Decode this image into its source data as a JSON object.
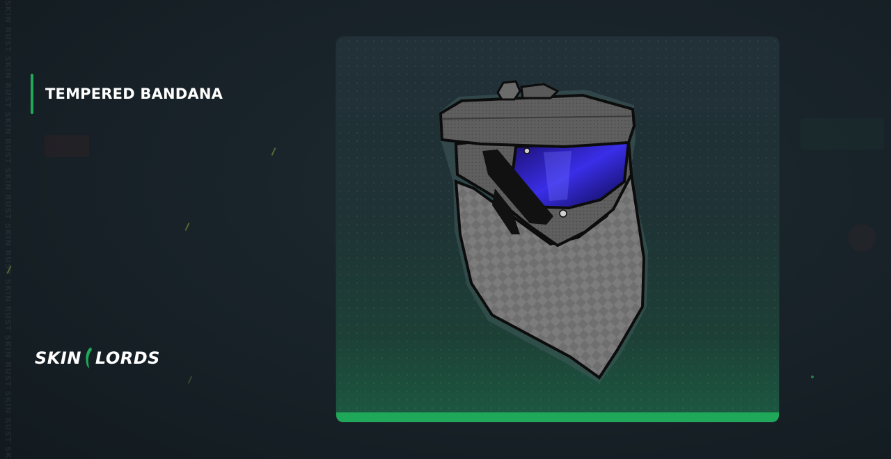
{
  "item": {
    "name": "TEMPERED BANDANA",
    "image_icon": "tempered-bandana-icon"
  },
  "brand": {
    "logo_left": "SKIN",
    "logo_right": "LORDS",
    "logo_icon": "skinlords-dragon-icon",
    "watermark": "SKIN RUST SKIN RUST SKIN RUST SKIN RUST SKIN RUST SKIN RUST SKIN RUST SKIN RUST SKIN RUST"
  },
  "colors": {
    "accent": "#1faa59",
    "background": "#172127",
    "card_top": "#223038",
    "card_bottom": "#1c5a42"
  }
}
